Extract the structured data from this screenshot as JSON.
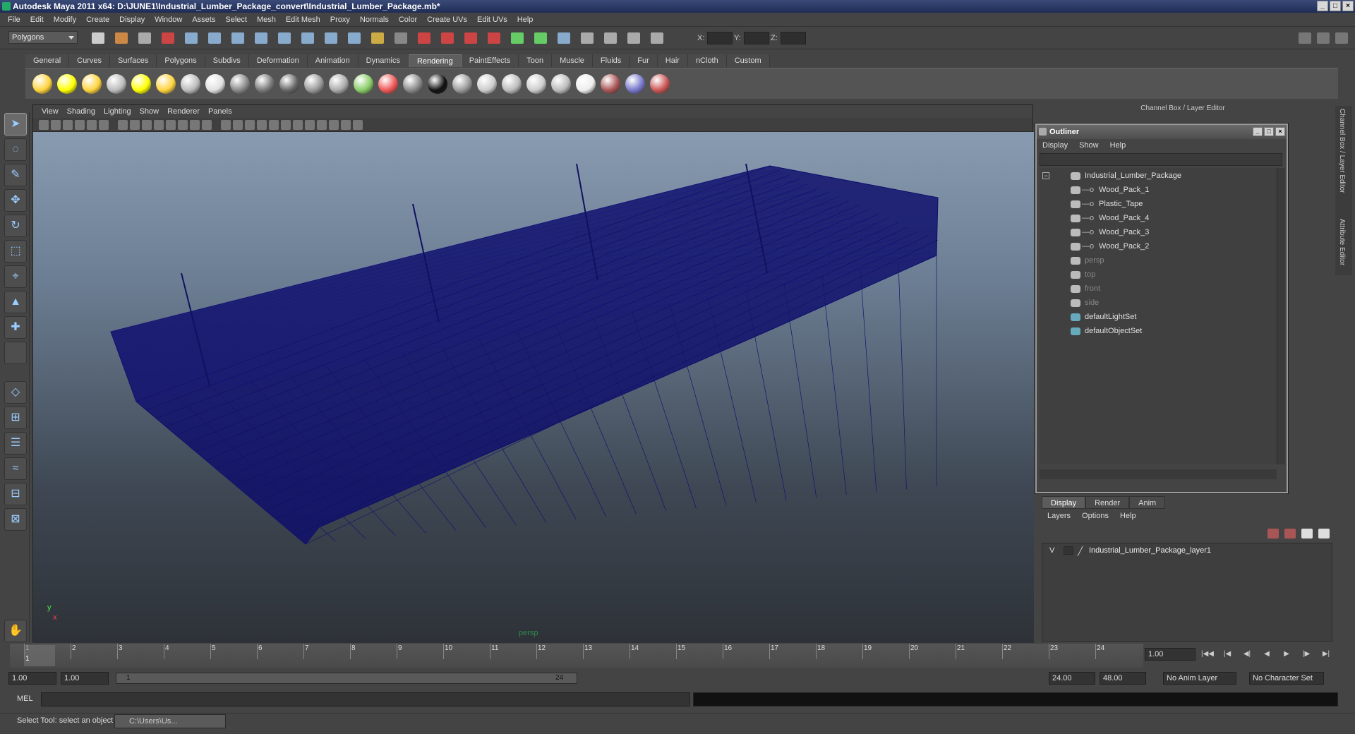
{
  "window": {
    "title": "Autodesk Maya 2011 x64: D:\\JUNE1\\Industrial_Lumber_Package_convert\\Industrial_Lumber_Package.mb*"
  },
  "menubar": [
    "File",
    "Edit",
    "Modify",
    "Create",
    "Display",
    "Window",
    "Assets",
    "Select",
    "Mesh",
    "Edit Mesh",
    "Proxy",
    "Normals",
    "Color",
    "Create UVs",
    "Edit UVs",
    "Help"
  ],
  "statusline": {
    "menuset": "Polygons",
    "x_label": "X:",
    "y_label": "Y:",
    "z_label": "Z:"
  },
  "shelf": {
    "tabs": [
      "General",
      "Curves",
      "Surfaces",
      "Polygons",
      "Subdivs",
      "Deformation",
      "Animation",
      "Dynamics",
      "Rendering",
      "PaintEffects",
      "Toon",
      "Muscle",
      "Fluids",
      "Fur",
      "Hair",
      "nCloth",
      "Custom"
    ],
    "active": "Rendering"
  },
  "viewport": {
    "menu": [
      "View",
      "Shading",
      "Lighting",
      "Show",
      "Renderer",
      "Panels"
    ],
    "camera": "persp",
    "axis_x": "x",
    "axis_y": "y",
    "wire_color": "#0d0d6b"
  },
  "channelbox": {
    "title": "Channel Box / Layer Editor",
    "side_tabs": [
      "Channel Box / Layer Editor",
      "Attribute Editor"
    ]
  },
  "outliner": {
    "title": "Outliner",
    "menu": [
      "Display",
      "Show",
      "Help"
    ],
    "items": [
      {
        "label": "Industrial_Lumber_Package",
        "icon": "group-icon",
        "dim": false
      },
      {
        "label": "Wood_Pack_1",
        "icon": "mesh-icon",
        "dim": false
      },
      {
        "label": "Plastic_Tape",
        "icon": "mesh-icon",
        "dim": false
      },
      {
        "label": "Wood_Pack_4",
        "icon": "mesh-icon",
        "dim": false
      },
      {
        "label": "Wood_Pack_3",
        "icon": "mesh-icon",
        "dim": false
      },
      {
        "label": "Wood_Pack_2",
        "icon": "mesh-icon",
        "dim": false
      },
      {
        "label": "persp",
        "icon": "camera-icon",
        "dim": true
      },
      {
        "label": "top",
        "icon": "camera-icon",
        "dim": true
      },
      {
        "label": "front",
        "icon": "camera-icon",
        "dim": true
      },
      {
        "label": "side",
        "icon": "camera-icon",
        "dim": true
      },
      {
        "label": "defaultLightSet",
        "icon": "set-icon",
        "dim": false
      },
      {
        "label": "defaultObjectSet",
        "icon": "set-icon",
        "dim": false
      }
    ]
  },
  "layers": {
    "tabs": [
      "Display",
      "Render",
      "Anim"
    ],
    "active": "Display",
    "menu": [
      "Layers",
      "Options",
      "Help"
    ],
    "visible_flag": "V",
    "layer_name": "Industrial_Lumber_Package_layer1"
  },
  "timeline": {
    "ticks": [
      "1",
      "2",
      "3",
      "4",
      "5",
      "6",
      "7",
      "8",
      "9",
      "10",
      "11",
      "12",
      "13",
      "14",
      "15",
      "16",
      "17",
      "18",
      "19",
      "20",
      "21",
      "22",
      "23",
      "24"
    ],
    "current_frame": "1.00",
    "current_marker": "1"
  },
  "range": {
    "start": "1.00",
    "playback_start": "1.00",
    "slider_start": "1",
    "slider_end": "24",
    "playback_end": "24.00",
    "end": "48.00",
    "anim_layer": "No Anim Layer",
    "char_set": "No Character Set"
  },
  "mel": {
    "label": "MEL"
  },
  "helpline": {
    "message": "Select Tool: select an object",
    "task": "C:\\Users\\Us..."
  }
}
